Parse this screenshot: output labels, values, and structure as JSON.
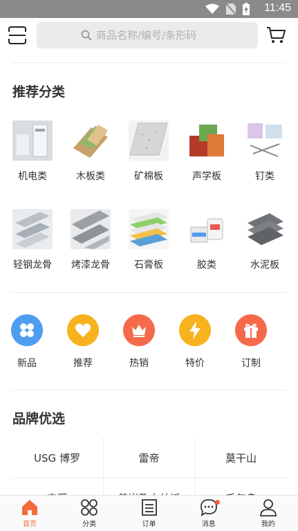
{
  "status_bar": {
    "time": "11:45"
  },
  "search": {
    "placeholder": "商品名称/编号/条形码"
  },
  "recommended": {
    "title": "推荐分类",
    "items": [
      {
        "label": "机电类",
        "icon": "electromechanical-thumb"
      },
      {
        "label": "木板类",
        "icon": "wood-board-thumb"
      },
      {
        "label": "矿棉板",
        "icon": "mineral-wool-board-thumb"
      },
      {
        "label": "声学板",
        "icon": "acoustic-board-thumb"
      },
      {
        "label": "钉类",
        "icon": "nails-thumb"
      },
      {
        "label": "轻钢龙骨",
        "icon": "light-steel-keel-thumb"
      },
      {
        "label": "烤漆龙骨",
        "icon": "painted-keel-thumb"
      },
      {
        "label": "石膏板",
        "icon": "gypsum-board-thumb"
      },
      {
        "label": "胶类",
        "icon": "glue-thumb"
      },
      {
        "label": "水泥板",
        "icon": "cement-board-thumb"
      }
    ]
  },
  "quick_links": [
    {
      "label": "新品",
      "icon": "new-icon",
      "color": "#4f9df0"
    },
    {
      "label": "推荐",
      "icon": "heart-icon",
      "color": "#f7b21e"
    },
    {
      "label": "热销",
      "icon": "crown-icon",
      "color": "#f56a4b"
    },
    {
      "label": "特价",
      "icon": "lightning-icon",
      "color": "#f7b21e"
    },
    {
      "label": "订制",
      "icon": "gift-icon",
      "color": "#f56a4b"
    }
  ],
  "brands": {
    "title": "品牌优选",
    "row1": [
      "USG 博罗",
      "雷帝",
      "莫干山"
    ],
    "row2": [
      "宝源",
      "美岩及木丝板",
      "千年舟"
    ]
  },
  "tabbar": [
    {
      "label": "首页",
      "icon": "home-icon",
      "active": true
    },
    {
      "label": "分类",
      "icon": "category-icon",
      "active": false
    },
    {
      "label": "订单",
      "icon": "order-icon",
      "active": false
    },
    {
      "label": "消息",
      "icon": "message-icon",
      "active": false
    },
    {
      "label": "我的",
      "icon": "profile-icon",
      "active": false
    }
  ],
  "colors": {
    "accent": "#f26b3a",
    "badge": "#ff5a36"
  }
}
